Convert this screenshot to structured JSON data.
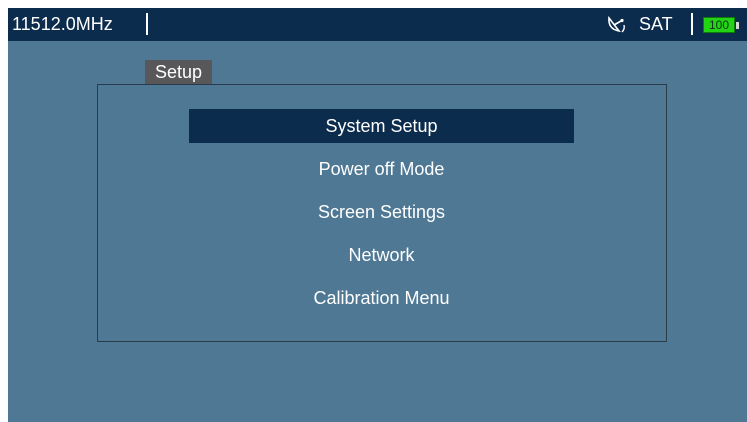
{
  "status_bar": {
    "frequency": "11512.0MHz",
    "mode_icon": "satellite-dish-icon",
    "mode_label": "SAT",
    "battery_level": "100",
    "battery_color": "#22d414"
  },
  "panel": {
    "title": "Setup"
  },
  "menu": {
    "selected_index": 0,
    "items": [
      {
        "label": "System Setup"
      },
      {
        "label": "Power off Mode"
      },
      {
        "label": "Screen Settings"
      },
      {
        "label": "Network"
      },
      {
        "label": "Calibration Menu"
      }
    ]
  },
  "colors": {
    "background": "#4f7895",
    "bar": "#0c2c4e",
    "selected": "#0c2c4e",
    "tab": "#58585a"
  }
}
